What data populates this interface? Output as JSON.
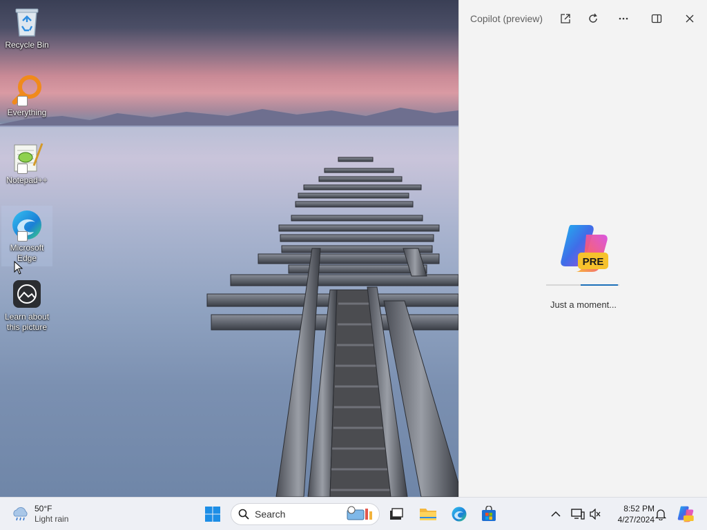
{
  "desktop": {
    "icons": [
      {
        "label": "Recycle Bin"
      },
      {
        "label": "Everything"
      },
      {
        "label": "Notepad++"
      },
      {
        "label": "Microsoft Edge"
      },
      {
        "label": "Learn about this picture"
      }
    ]
  },
  "copilot": {
    "title": "Copilot (preview)",
    "logo_badge": "PRE",
    "loading_text": "Just a moment...",
    "icons": [
      "open-in-new-window-icon",
      "refresh-icon",
      "more-options-icon",
      "dock-panel-icon",
      "close-icon"
    ]
  },
  "taskbar": {
    "weather": {
      "temperature": "50°F",
      "condition": "Light rain"
    },
    "search": {
      "label": "Search"
    },
    "apps": [
      "start-icon",
      "search-icon",
      "task-view-icon",
      "file-explorer-icon",
      "edge-icon",
      "store-icon"
    ],
    "clock": {
      "time": "8:52 PM",
      "date": "4/27/2024"
    }
  },
  "colors": {
    "accent": "#1b6fb8",
    "pane_bg": "#f3f3f3",
    "taskbar_bg": "#eef0f5"
  }
}
